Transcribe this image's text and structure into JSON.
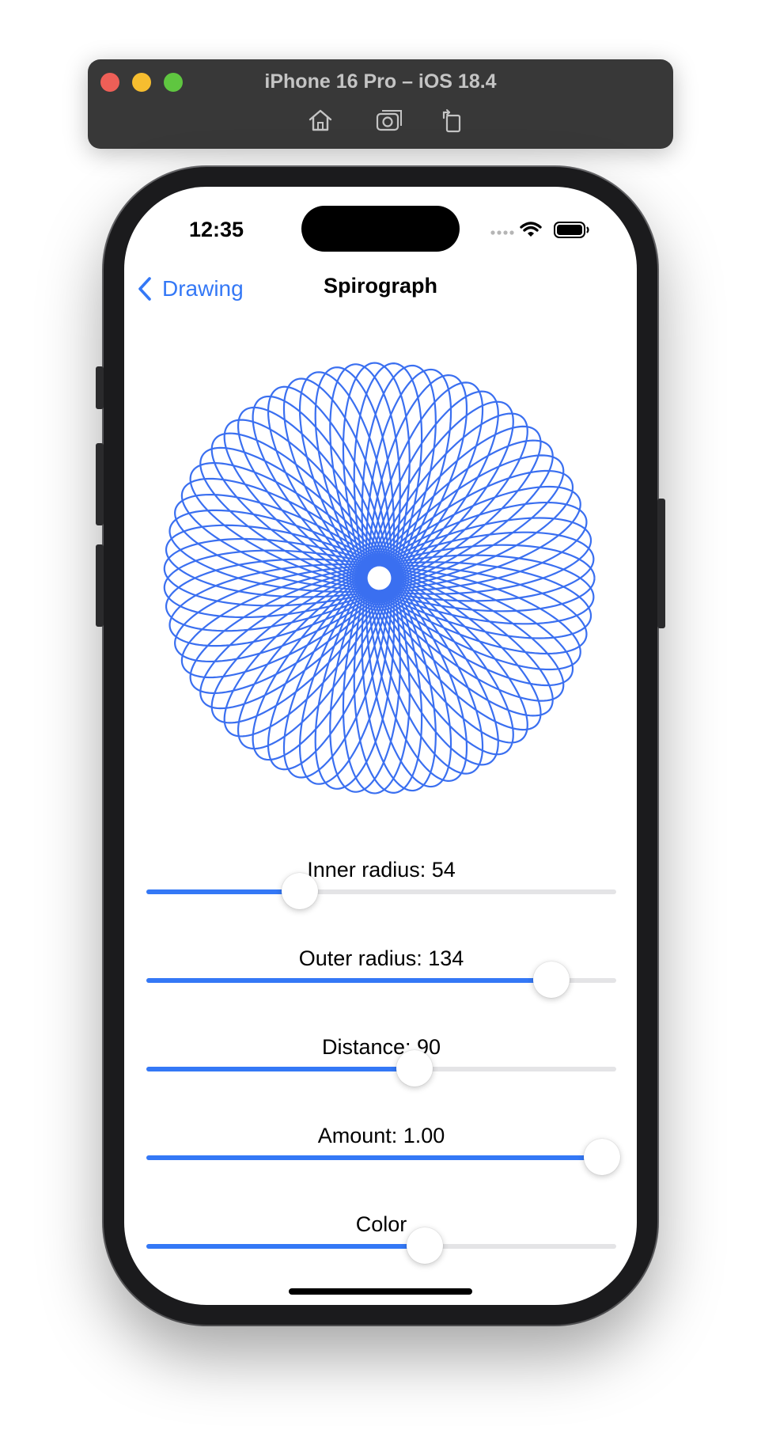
{
  "simulator": {
    "title": "iPhone 16 Pro – iOS 18.4",
    "tools": [
      {
        "icon": "home-icon"
      },
      {
        "icon": "screenshot-icon"
      },
      {
        "icon": "rotate-icon"
      }
    ]
  },
  "status_bar": {
    "time": "12:35",
    "icons": [
      "signal-icon",
      "wifi-icon",
      "battery-icon"
    ]
  },
  "nav": {
    "back_label": "Drawing",
    "title": "Spirograph"
  },
  "spirograph": {
    "color": "#3a6ff0"
  },
  "sliders": [
    {
      "label": "Inner radius: 54",
      "value_fraction": 0.326
    },
    {
      "label": "Outer radius: 134",
      "value_fraction": 0.862
    },
    {
      "label": "Distance: 90",
      "value_fraction": 0.57
    },
    {
      "label": "Amount: 1.00",
      "value_fraction": 0.97
    },
    {
      "label": "Color",
      "value_fraction": 0.593
    }
  ],
  "colors": {
    "accent": "#3478f6",
    "track": "#e4e4e6"
  }
}
